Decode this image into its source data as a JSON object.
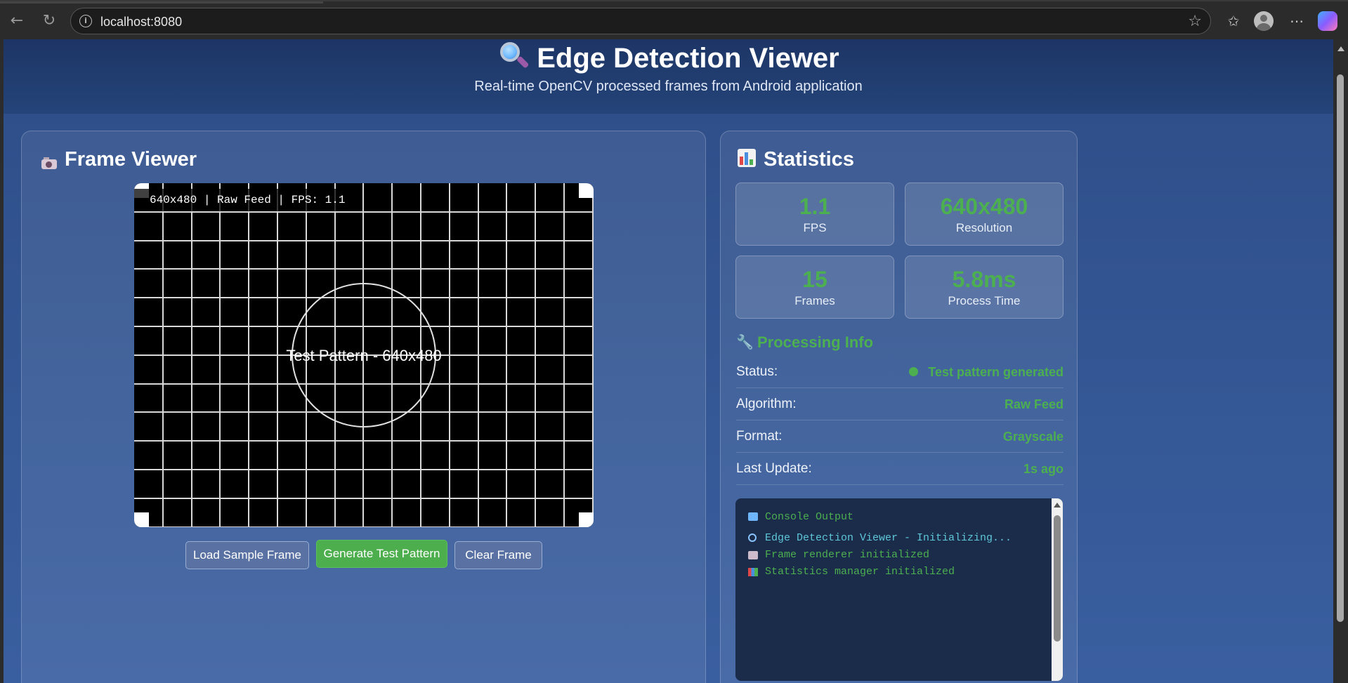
{
  "browser": {
    "url": "localhost:8080",
    "back_icon": "arrow-left-icon",
    "reload_icon": "reload-icon",
    "star_icon": "star-icon"
  },
  "header": {
    "title": "Edge Detection Viewer",
    "subtitle": "Real-time OpenCV processed frames from Android application"
  },
  "frame_viewer": {
    "title": "Frame Viewer",
    "overlay": "640x480 | Raw Feed | FPS: 1.1",
    "pattern_text": "Test Pattern - 640x480",
    "buttons": {
      "load": "Load Sample Frame",
      "generate": "Generate Test Pattern",
      "clear": "Clear Frame"
    }
  },
  "statistics": {
    "title": "Statistics",
    "cards": [
      {
        "value": "1.1",
        "label": "FPS"
      },
      {
        "value": "640x480",
        "label": "Resolution"
      },
      {
        "value": "15",
        "label": "Frames"
      },
      {
        "value": "5.8ms",
        "label": "Process Time"
      }
    ],
    "processing_title": "Processing Info",
    "info": [
      {
        "key": "Status:",
        "value": "Test pattern generated"
      },
      {
        "key": "Algorithm:",
        "value": "Raw Feed"
      },
      {
        "key": "Format:",
        "value": "Grayscale"
      },
      {
        "key": "Last Update:",
        "value": "1s ago"
      }
    ],
    "console": {
      "title": "Console Output",
      "lines": [
        "Edge Detection Viewer - Initializing...",
        "Frame renderer initialized",
        "Statistics manager initialized"
      ]
    }
  },
  "colors": {
    "accent_green": "#4caf50",
    "page_bg": "#2d4d87",
    "console_cyan": "#5ec8d8"
  }
}
